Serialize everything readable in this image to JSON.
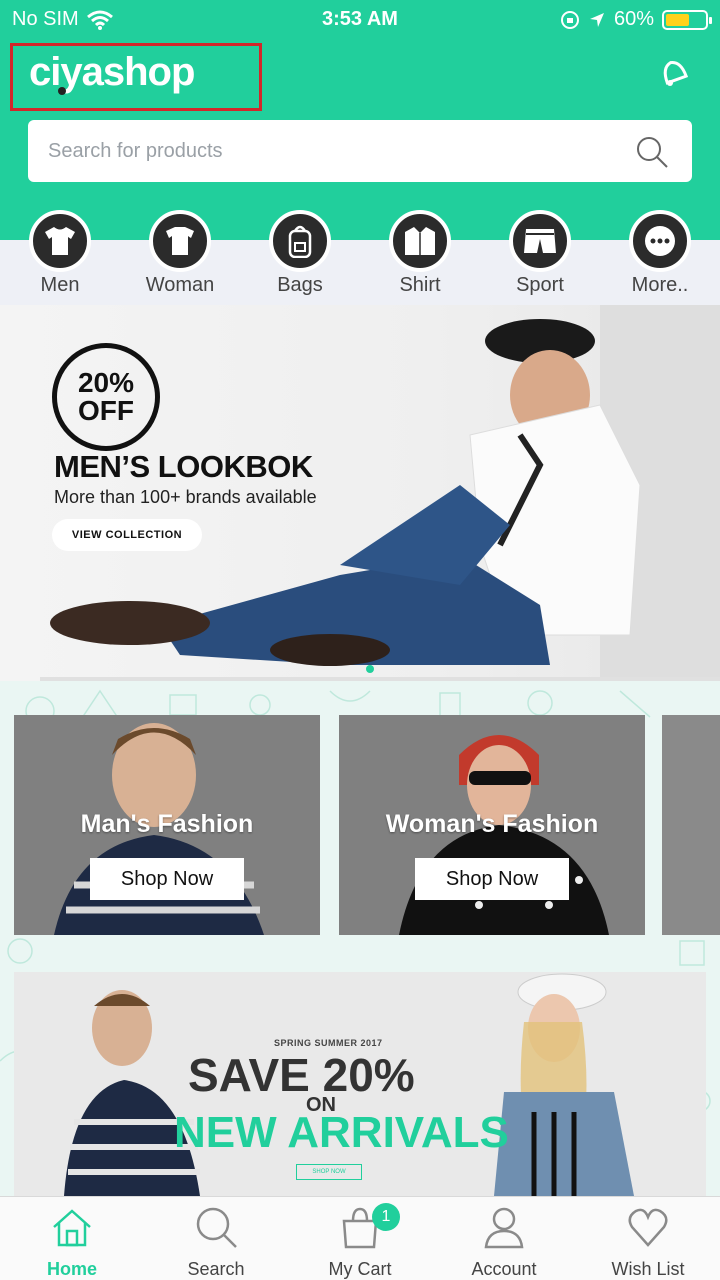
{
  "status_bar": {
    "carrier": "No SIM",
    "time": "3:53 AM",
    "battery": "60%",
    "battery_level": 0.6
  },
  "header": {
    "logo": "ciyashop",
    "search_placeholder": "Search for products",
    "accent_color": "#21cf9c"
  },
  "categories": [
    {
      "label": "Men",
      "icon": "tshirt-icon"
    },
    {
      "label": "Woman",
      "icon": "top-icon"
    },
    {
      "label": "Bags",
      "icon": "backpack-icon"
    },
    {
      "label": "Shirt",
      "icon": "shirt-icon"
    },
    {
      "label": "Sport",
      "icon": "shorts-icon"
    },
    {
      "label": "More..",
      "icon": "more-icon"
    }
  ],
  "hero_banner": {
    "discount_pct": "20%",
    "discount_off": "OFF",
    "title": "MEN’S LOOKBOK",
    "subtitle": "More than 100+ brands available",
    "button": "VIEW COLLECTION"
  },
  "fashion_cards": [
    {
      "title": "Man's Fashion",
      "button": "Shop Now"
    },
    {
      "title": "Woman's Fashion",
      "button": "Shop Now"
    }
  ],
  "promo_banner": {
    "tagline": "SPRING SUMMER 2017",
    "headline": "SAVE 20%",
    "on": "ON",
    "highlight": "NEW ARRIVALS",
    "button": "SHOP NOW"
  },
  "tabbar": {
    "items": [
      {
        "label": "Home",
        "icon": "home-icon",
        "active": true
      },
      {
        "label": "Search",
        "icon": "search-icon"
      },
      {
        "label": "My Cart",
        "icon": "shopping-bag-icon",
        "badge": "1"
      },
      {
        "label": "Account",
        "icon": "user-icon"
      },
      {
        "label": "Wish List",
        "icon": "heart-icon"
      }
    ]
  }
}
